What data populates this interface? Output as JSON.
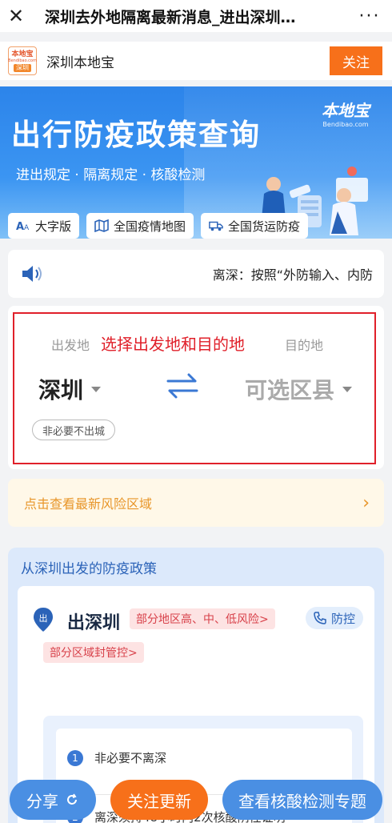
{
  "topbar": {
    "close_glyph": "✕",
    "title": "深圳去外地隔离最新消息_进出深圳…",
    "more_glyph": "···"
  },
  "account": {
    "logo": {
      "line1": "本地宝",
      "line2": "Bendibao.com",
      "line3": "深圳"
    },
    "name": "深圳本地宝",
    "follow_label": "关注"
  },
  "banner": {
    "title": "出行防疫政策查询",
    "subtitle": "进出规定 · 隔离规定 · 核酸检测",
    "brand": "本地宝",
    "brand_url": "Bendibao.com",
    "chips": [
      {
        "icon": "font-size-icon",
        "label": "大字版"
      },
      {
        "icon": "map-icon",
        "label": "全国疫情地图"
      },
      {
        "icon": "truck-icon",
        "label": "全国货运防疫"
      }
    ]
  },
  "notice": {
    "icon": "speaker-icon",
    "text": "离深：按照“外防输入、内防"
  },
  "picker": {
    "from_label": "出发地",
    "to_label": "目的地",
    "overlay_text": "选择出发地和目的地",
    "from_value": "深圳",
    "to_value": "可选区县",
    "tag": "非必要不出城"
  },
  "risk": {
    "text": "点击查看最新风险区域",
    "chevron": "›"
  },
  "policy": {
    "title": "从深圳出发的防疫政策",
    "pin_label": "出",
    "place": "出深圳",
    "tags": [
      "部分地区高、中、低风险>",
      "部分区域封管控>"
    ],
    "control_label": "防控",
    "items": [
      {
        "num": "1",
        "text": "非必要不离深"
      },
      {
        "num": "2",
        "text": "离深须持48小时内2次核酸阴性证明"
      }
    ]
  },
  "bottom": {
    "share_label": "分享",
    "follow_label": "关注更新",
    "test_label": "查看核酸检测专题"
  },
  "colors": {
    "orange": "#f7701a",
    "blue": "#4a8fe3",
    "banner": "#2c84ea",
    "red_box": "#e0202a",
    "risk_text": "#e8962a"
  }
}
